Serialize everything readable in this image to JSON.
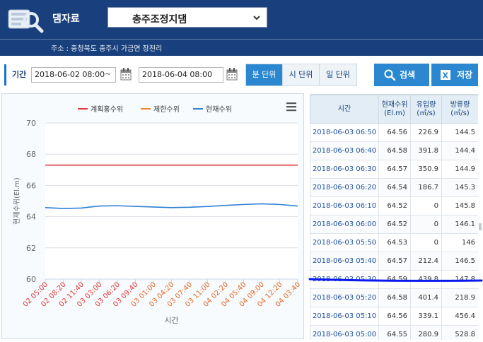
{
  "header": {
    "title": "댐자료",
    "dam_name": "충주조정지댐",
    "address": "주소 : 충청북도 충주시 가금면 장천리"
  },
  "search": {
    "period_label": "기간",
    "start_date": "2018-06-02 08:00",
    "end_date": "2018-06-04 08:00",
    "tilde": "~",
    "units": [
      "분 단위",
      "시 단위",
      "일 단위"
    ],
    "active_unit": 0,
    "search_label": "검색",
    "save_label": "저장"
  },
  "colors": {
    "header_bg": "#19407c",
    "accent": "#2b88d0",
    "flood_line": "#e03a3a",
    "limit_line": "#ee8833",
    "current_line": "#2f7fd4",
    "annotation": "#0a1aee"
  },
  "icons": {
    "logo": "dam-data-logo-icon",
    "select": "chevron-down-icon",
    "calendar": "calendar-icon",
    "search": "search-icon",
    "save": "excel-icon",
    "menu": "hamburger-menu-icon"
  },
  "chart_data": {
    "type": "line",
    "title": "",
    "xlabel": "시간",
    "ylabel": "현재수위(El.m)",
    "ylim": [
      60,
      70
    ],
    "yticks": [
      60,
      62,
      64,
      66,
      68,
      70
    ],
    "grid": true,
    "legend_position": "top",
    "x": [
      "02 05:00",
      "02 08:20",
      "02 11:40",
      "03 03:00",
      "03 06:20",
      "03 09:40",
      "03 01:00",
      "03 04:20",
      "03 07:40",
      "03 11:00",
      "04 02:20",
      "04 05:40",
      "04 09:00",
      "04 12:20",
      "04 03:40"
    ],
    "x_red_labels": 6,
    "series": [
      {
        "name": "계획홍수위",
        "values": [
          67.3,
          67.3,
          67.3,
          67.3,
          67.3,
          67.3,
          67.3,
          67.3,
          67.3,
          67.3,
          67.3,
          67.3,
          67.3,
          67.3,
          67.3
        ]
      },
      {
        "name": "제한수위",
        "values": []
      },
      {
        "name": "현재수위",
        "values": [
          64.58,
          64.52,
          64.55,
          64.68,
          64.7,
          64.66,
          64.62,
          64.58,
          64.6,
          64.65,
          64.72,
          64.78,
          64.82,
          64.78,
          64.68
        ]
      }
    ]
  },
  "table": {
    "headers": [
      "시간",
      "현재수위\n(El.m)",
      "유입량\n(㎥/s)",
      "방류량\n(㎥/s)"
    ],
    "rows": [
      [
        "2018-06-03 06:50",
        "64.56",
        "226.9",
        "144.5"
      ],
      [
        "2018-06-03 06:40",
        "64.58",
        "391.8",
        "144.4"
      ],
      [
        "2018-06-03 06:30",
        "64.57",
        "350.9",
        "144.9"
      ],
      [
        "2018-06-03 06:20",
        "64.54",
        "186.7",
        "145.3"
      ],
      [
        "2018-06-03 06:10",
        "64.52",
        "0",
        "145.8"
      ],
      [
        "2018-06-03 06:00",
        "64.52",
        "0",
        "146.1"
      ],
      [
        "2018-06-03 05:50",
        "64.53",
        "0",
        "146"
      ],
      [
        "2018-06-03 05:40",
        "64.57",
        "212.4",
        "146.5"
      ],
      [
        "2018-06-03 05:30",
        "64.59",
        "439.8",
        "147.8"
      ],
      [
        "2018-06-03 05:20",
        "64.58",
        "401.4",
        "218.9"
      ],
      [
        "2018-06-03 05:10",
        "64.56",
        "339.1",
        "456.4"
      ],
      [
        "2018-06-03 05:00",
        "64.55",
        "280.9",
        "528.8"
      ]
    ]
  }
}
